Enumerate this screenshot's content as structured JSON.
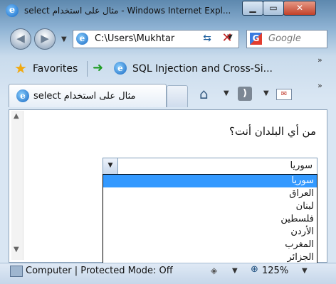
{
  "window": {
    "title": "select مثال على استخدام - Windows Internet Expl...",
    "ie_letter": "e"
  },
  "nav": {
    "back_glyph": "◀",
    "forward_glyph": "▶",
    "address": "C:\\Users\\Mukhtar",
    "refresh_glyph": "⇆",
    "stop_glyph": "✕",
    "search_placeholder": "Google",
    "search_logo_letter": "G"
  },
  "favorites": {
    "label": "Favorites",
    "link": "SQL Injection and Cross-Si..."
  },
  "tab": {
    "label": "select مثال على استخدام"
  },
  "page": {
    "question": "من أي البلدان أنت؟",
    "selected": "سوريا",
    "options": [
      "سوريا",
      "العراق",
      "لبنان",
      "فلسطين",
      "الأردن",
      "المغرب",
      "الجزائر"
    ]
  },
  "status": {
    "text": "Computer | Protected Mode: Off",
    "zoom": "125%"
  },
  "colors": {
    "selection": "#3399ff",
    "title_gradient_top": "#5d88ae",
    "close_button": "#c1412a"
  }
}
